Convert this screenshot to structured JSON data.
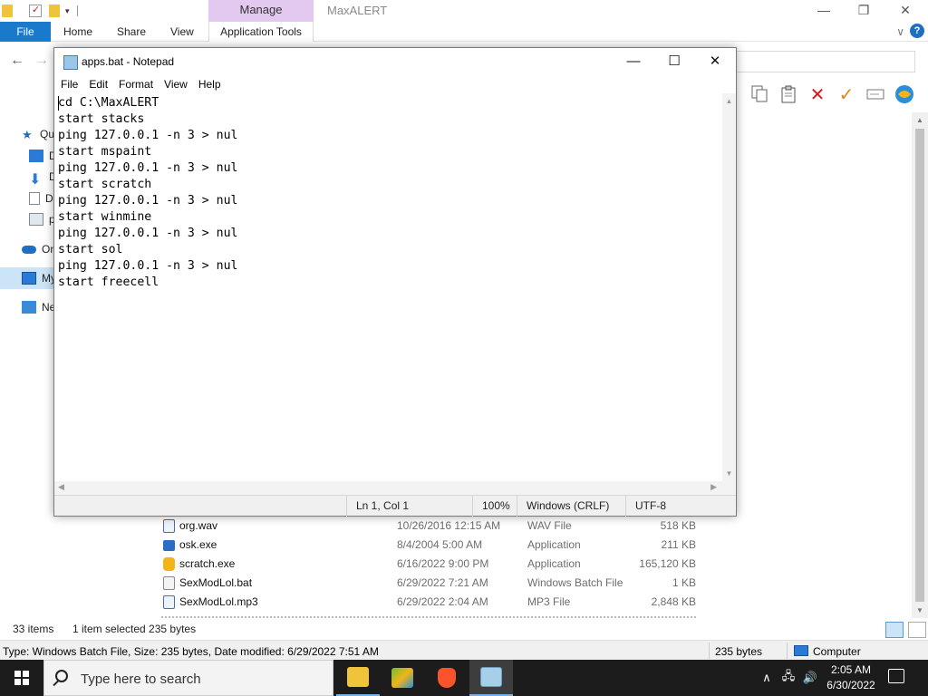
{
  "explorer": {
    "title": "MaxALERT",
    "contextual_tab": "Manage",
    "ribbon_tabs": [
      "File",
      "Home",
      "Share",
      "View",
      "Application Tools"
    ],
    "help": "?",
    "sidebar": [
      "Qu",
      "D",
      "D",
      "D",
      "p",
      "On",
      "My",
      "Ne"
    ],
    "files": [
      {
        "name": "org.wav",
        "date": "10/26/2016 12:15 AM",
        "type": "WAV File",
        "size": "518 KB",
        "icon": "wav-file-icon",
        "color": "#4a6fa5"
      },
      {
        "name": "osk.exe",
        "date": "8/4/2004 5:00 AM",
        "type": "Application",
        "size": "211 KB",
        "icon": "keyboard-app-icon",
        "color": "#2b6cc4"
      },
      {
        "name": "scratch.exe",
        "date": "6/16/2022 9:00 PM",
        "type": "Application",
        "size": "165,120 KB",
        "icon": "scratch-app-icon",
        "color": "#f2b417"
      },
      {
        "name": "SexModLol.bat",
        "date": "6/29/2022 7:21 AM",
        "type": "Windows Batch File",
        "size": "1 KB",
        "icon": "batch-file-icon",
        "color": "#8a8a8a"
      },
      {
        "name": "SexModLol.mp3",
        "date": "6/29/2022 2:04 AM",
        "type": "MP3 File",
        "size": "2,848 KB",
        "icon": "mp3-file-icon",
        "color": "#4a6fa5"
      }
    ],
    "status": {
      "item_count": "33 items",
      "selection": "1 item selected  235 bytes"
    },
    "details": {
      "text": "Type: Windows Batch File, Size: 235 bytes, Date modified: 6/29/2022 7:51 AM",
      "size": "235 bytes",
      "location": "Computer"
    }
  },
  "notepad": {
    "title": "apps.bat - Notepad",
    "menu": [
      "File",
      "Edit",
      "Format",
      "View",
      "Help"
    ],
    "content": "cd C:\\MaxALERT\nstart stacks\nping 127.0.0.1 -n 3 > nul\nstart mspaint\nping 127.0.0.1 -n 3 > nul\nstart scratch\nping 127.0.0.1 -n 3 > nul\nstart winmine\nping 127.0.0.1 -n 3 > nul\nstart sol\nping 127.0.0.1 -n 3 > nul\nstart freecell",
    "status": {
      "position": "Ln 1, Col 1",
      "zoom": "100%",
      "line_ending": "Windows (CRLF)",
      "encoding": "UTF-8"
    }
  },
  "taskbar": {
    "search_placeholder": "Type here to search",
    "apps": [
      {
        "name": "file-explorer",
        "color": "#f0c43a"
      },
      {
        "name": "bluestacks",
        "color": "#6cbf3a"
      },
      {
        "name": "brave-browser",
        "color": "#fb542b"
      },
      {
        "name": "notepad",
        "color": "#a8cfe8"
      }
    ],
    "time": "2:05 AM",
    "date": "6/30/2022"
  },
  "colors": {
    "accent": "#1979ca",
    "manage_tab": "#e3c9f0"
  }
}
